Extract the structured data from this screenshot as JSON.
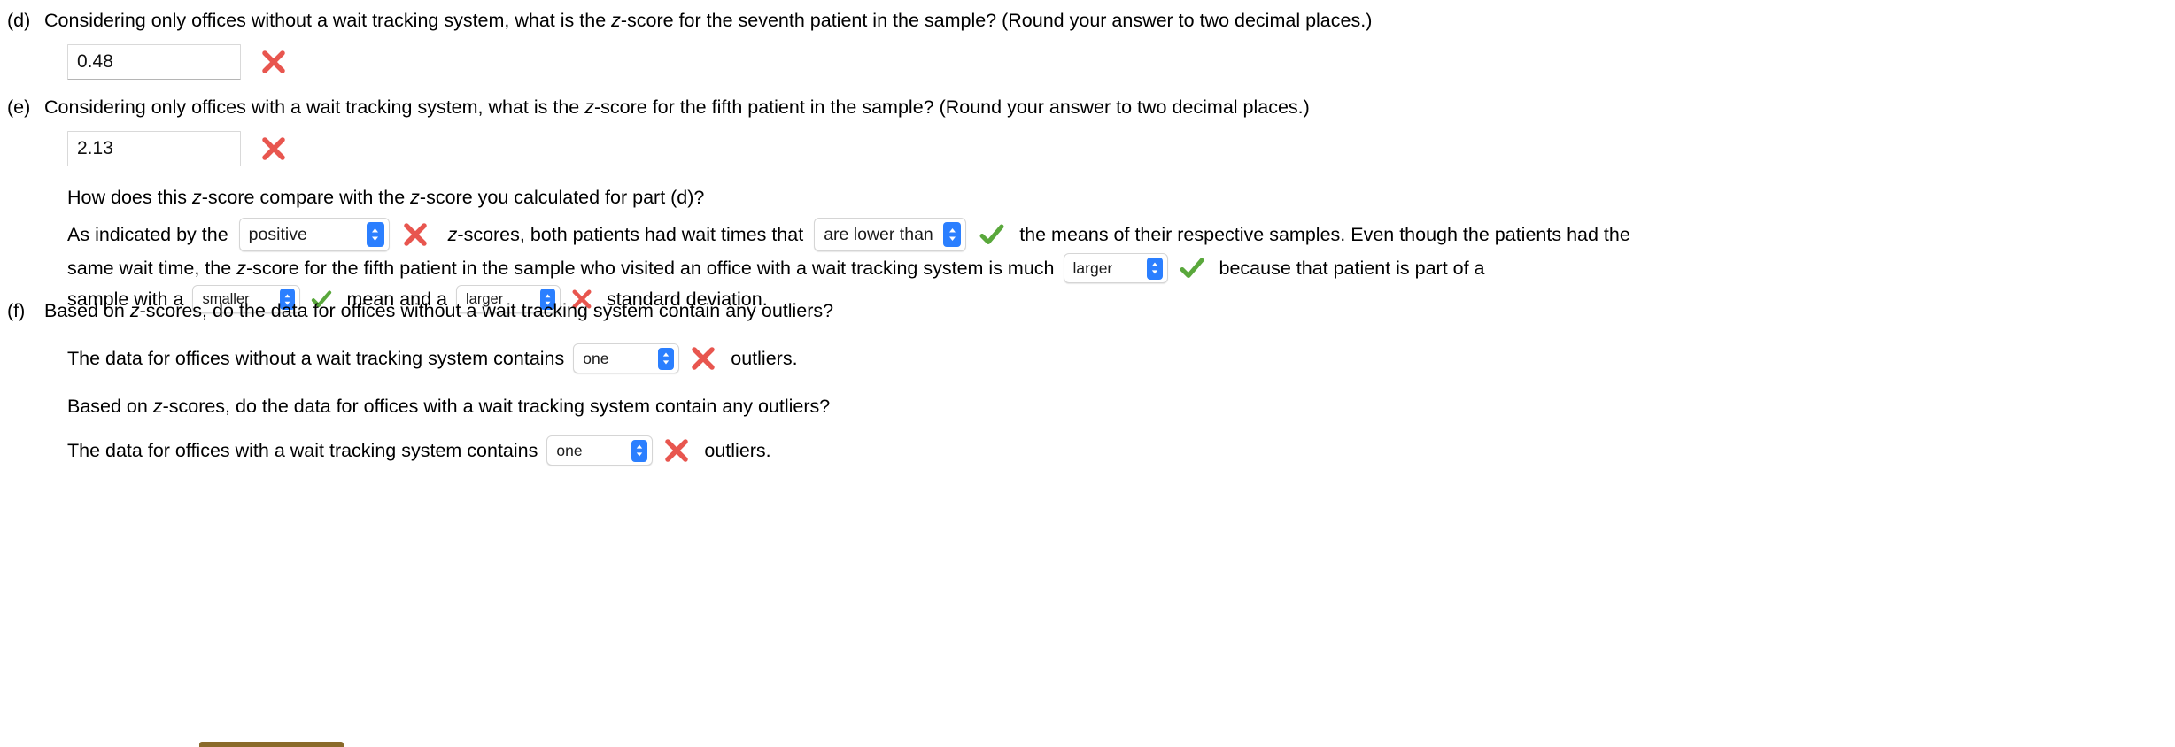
{
  "parts": {
    "d": {
      "label": "(d)",
      "question_pre": "Considering only offices without a wait tracking system, what is the ",
      "question_ital": "z",
      "question_post": "-score for the seventh patient in the sample? (Round your answer to two decimal places.)",
      "answer_value": "0.48",
      "answer_placeholder": "",
      "mark": "incorrect"
    },
    "e": {
      "label": "(e)",
      "question_pre": "Considering only offices with a wait tracking system, what is the ",
      "question_ital": "z",
      "question_post": "-score for the fifth patient in the sample? (Round your answer to two decimal places.)",
      "answer_value": "2.13",
      "answer_placeholder": "",
      "mark": "incorrect",
      "compare_pre": "How does this ",
      "compare_ital1": "z",
      "compare_mid": "-score compare with the ",
      "compare_ital2": "z",
      "compare_post": "-score you calculated for part (d)?",
      "line1_a": "As indicated by the",
      "select_sign": "positive",
      "select_sign_mark": "incorrect",
      "line1_b_ital": "z",
      "line1_b": "-scores, both patients had wait times that",
      "select_compare": "are lower than",
      "select_compare_mark": "correct",
      "line1_c": "the means of their respective samples. Even though the patients had the",
      "line2_a": "same wait time, the ",
      "line2_ital": "z",
      "line2_b": "-score for the fifth patient in the sample who visited an office with a wait tracking system is much",
      "select_magnitude": "larger",
      "select_magnitude_mark": "correct",
      "line2_c": "because that patient is part of a",
      "line3_a": "sample with a",
      "select_mean": "smaller",
      "select_mean_mark": "correct",
      "line3_b": "mean and a",
      "select_sd": "larger",
      "select_sd_mark": "incorrect",
      "line3_c": "standard deviation."
    },
    "f": {
      "label": "(f)",
      "question_pre": "Based on ",
      "question_ital": "z",
      "question_post": "-scores, do the data for offices without a wait tracking system contain any outliers?",
      "answer_line_a": "The data for offices without a wait tracking system contains",
      "select_without": "one",
      "select_without_mark": "incorrect",
      "answer_line_b": "outliers.",
      "question2_pre": "Based on ",
      "question2_ital": "z",
      "question2_post": "-scores, do the data for offices with a wait tracking system contain any outliers?",
      "answer2_line_a": "The data for offices with a wait tracking system contains",
      "select_with": "one",
      "select_with_mark": "incorrect",
      "answer2_line_b": "outliers."
    }
  },
  "icons": {
    "incorrect": "red-x-icon",
    "correct": "green-check-icon",
    "stepper": "stepper-chevrons-icon"
  },
  "colors": {
    "incorrect": "#e8564f",
    "correct": "#5aa83c",
    "stepper_blue": "#2b7fff",
    "bottom_button": "#8a6a2a",
    "text": "#000000"
  }
}
